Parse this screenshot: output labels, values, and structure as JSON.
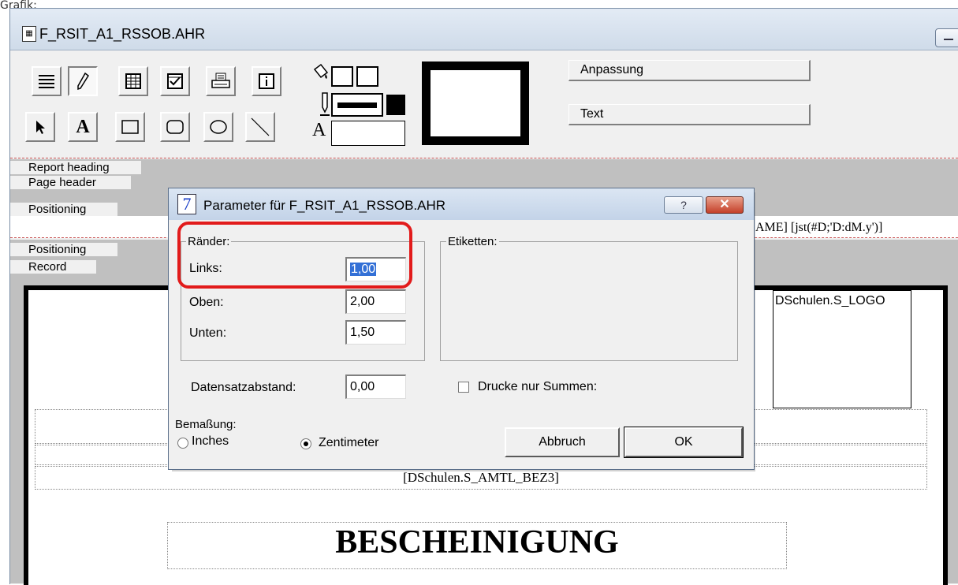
{
  "page_caption": "Grafik:",
  "window": {
    "title": "F_RSIT_A1_RSSOB.AHR"
  },
  "toolbar": {
    "buttons_right": {
      "anpassung": "Anpassung",
      "text": "Text"
    },
    "font_sample_glyph": "A"
  },
  "bands": [
    "Report heading",
    "Page header",
    "Positioning",
    "Positioning",
    "Record"
  ],
  "report": {
    "header_expr": "AME]  [jst(#D;'D:dM.y')]",
    "logo_field": "DSchulen.S_LOGO",
    "amtl_field": "[DSchulen.S_AMTL_BEZ3]",
    "heading": "BESCHEINIGUNG"
  },
  "dialog": {
    "icon_glyph": "7",
    "title": "Parameter für F_RSIT_A1_RSSOB.AHR",
    "help_label": "?",
    "close_label": "✕",
    "margins": {
      "group_label": "Ränder:",
      "links_label": "Links:",
      "links_value": "1,00",
      "oben_label": "Oben:",
      "oben_value": "2,00",
      "unten_label": "Unten:",
      "unten_value": "1,50"
    },
    "labels_group": "Etiketten:",
    "record_spacing_label": "Datensatzabstand:",
    "record_spacing_value": "0,00",
    "print_sums_label": "Drucke nur Summen:",
    "print_sums_checked": false,
    "units_label": "Bemaßung:",
    "unit_inches": "Inches",
    "unit_cm": "Zentimeter",
    "selected_unit": "cm",
    "cancel_label": "Abbruch",
    "ok_label": "OK"
  },
  "colors": {
    "highlight": "#e21b1b",
    "band_gray": "#c0c0c0",
    "dialog_icon": "#1a3ec8"
  }
}
